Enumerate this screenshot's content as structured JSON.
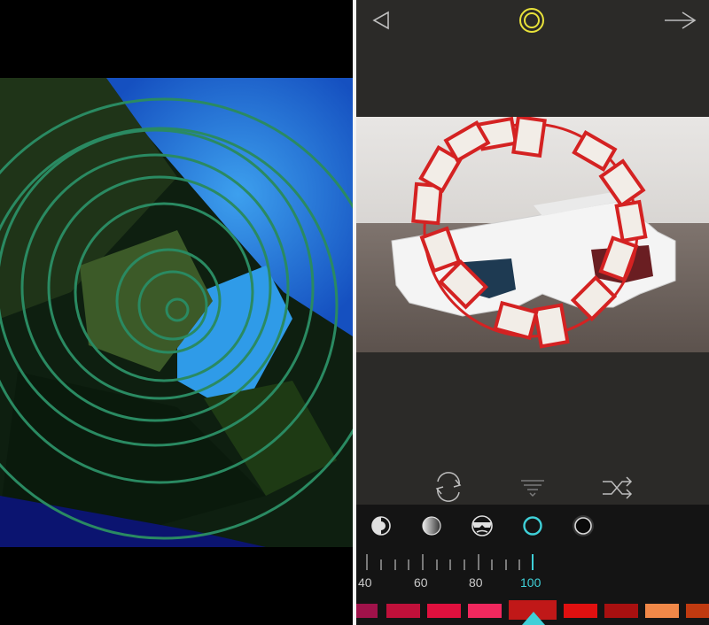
{
  "toolbar": {
    "back_icon": "triangle-left-icon",
    "mode_icon": "double-ring-icon",
    "next_icon": "arrow-right-icon",
    "accent_color": "#e8e23a"
  },
  "tools": {
    "rotate_icon": "rotate-icon",
    "collapse_icon": "chevron-down-lines-icon",
    "shuffle_icon": "shuffle-icon"
  },
  "filters": {
    "items": [
      {
        "name": "half-circle-icon"
      },
      {
        "name": "gradient-circle-icon"
      },
      {
        "name": "mask-icon"
      },
      {
        "name": "ring-icon",
        "selected": true
      },
      {
        "name": "glow-circle-icon"
      }
    ],
    "selected_color": "#3fd0d8"
  },
  "slider": {
    "labels": [
      "40",
      "60",
      "80",
      "100"
    ],
    "value": 100
  },
  "palette": {
    "colors": [
      "#a0124a",
      "#c0103a",
      "#e0103e",
      "#f0285e",
      "#c01818",
      "#e01010",
      "#a81010",
      "#f08848",
      "#c03a10"
    ],
    "selected_index": 4
  }
}
